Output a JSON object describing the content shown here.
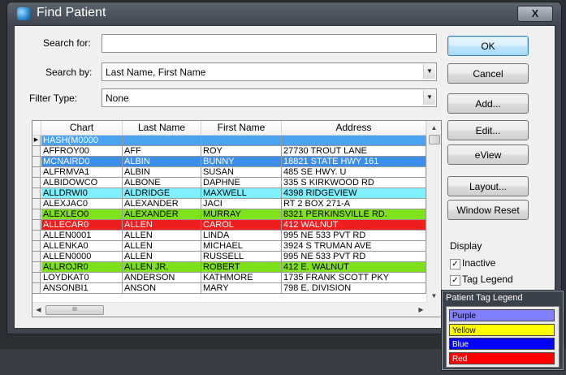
{
  "window": {
    "title": "Find Patient",
    "close_label": "X"
  },
  "search": {
    "search_for_label": "Search for:",
    "search_for_value": "",
    "search_by_label": "Search by:",
    "search_by_value": "Last Name, First Name",
    "filter_type_label": "Filter Type:",
    "filter_type_value": "None"
  },
  "buttons": {
    "ok": "OK",
    "cancel": "Cancel",
    "add": "Add...",
    "edit": "Edit...",
    "eview": "eView",
    "layout": "Layout...",
    "window_reset": "Window Reset"
  },
  "display": {
    "label": "Display",
    "inactive_label": "Inactive",
    "inactive_checked": true,
    "tag_legend_label": "Tag Legend",
    "tag_legend_checked": true
  },
  "grid": {
    "columns": [
      "Chart",
      "Last Name",
      "First Name",
      "Address"
    ],
    "rows": [
      {
        "cells": [
          "HASH(M0000",
          "",
          "",
          ""
        ],
        "tag": "selected",
        "current": true
      },
      {
        "cells": [
          "AFFROY00",
          "AFF",
          "ROY",
          "27730 TROUT LANE"
        ],
        "tag": "none"
      },
      {
        "cells": [
          "MCNAIRD0",
          "ALBIN",
          "BUNNY",
          "18821 STATE HWY 161"
        ],
        "tag": "blue"
      },
      {
        "cells": [
          "ALFRMVA1",
          "ALBIN",
          "SUSAN",
          "485 SE HWY. U"
        ],
        "tag": "none"
      },
      {
        "cells": [
          "ALBIDOWCO",
          "ALBONE",
          "DAPHNE",
          "335 S KIRKWOOD RD"
        ],
        "tag": "none"
      },
      {
        "cells": [
          "ALLDRWI0",
          "ALDRIDGE",
          "MAXWELL",
          "4398 RIDGEVIEW"
        ],
        "tag": "cyan"
      },
      {
        "cells": [
          "ALEXJAC0",
          "ALEXANDER",
          "JACI",
          "RT 2 BOX 271-A"
        ],
        "tag": "none"
      },
      {
        "cells": [
          "ALEXLEO0",
          "ALEXANDER",
          "MURRAY",
          "8321 PERKINSVILLE RD."
        ],
        "tag": "green"
      },
      {
        "cells": [
          "ALLECAR0",
          "ALLEN",
          "CAROL",
          "412 WALNUT"
        ],
        "tag": "red"
      },
      {
        "cells": [
          "ALLEN0001",
          "ALLEN",
          "LINDA",
          "995 NE 533 PVT RD"
        ],
        "tag": "none"
      },
      {
        "cells": [
          "ALLENKA0",
          "ALLEN",
          "MICHAEL",
          "3924 S TRUMAN AVE"
        ],
        "tag": "none"
      },
      {
        "cells": [
          "ALLEN0000",
          "ALLEN",
          "RUSSELL",
          "995 NE 533 PVT RD"
        ],
        "tag": "none"
      },
      {
        "cells": [
          "ALLROJR0",
          "ALLEN JR.",
          "ROBERT",
          "412 E. WALNUT"
        ],
        "tag": "green"
      },
      {
        "cells": [
          "LOYDKAT0",
          "ANDERSON",
          "KATHMORE",
          "1735 FRANK SCOTT PKY"
        ],
        "tag": "none"
      },
      {
        "cells": [
          "ANSONBI1",
          "ANSON",
          "MARY",
          "798 E. DIVISION"
        ],
        "tag": "none"
      }
    ],
    "scroll_grip": "III"
  },
  "tag_colors": {
    "selected": "#4aa3f0",
    "blue": "#3d8ee8",
    "cyan": "#7ff0ff",
    "green": "#7fe01c",
    "red": "#f01e1e",
    "none": "#ffffff"
  },
  "legend": {
    "title": "Patient Tag Legend",
    "items": [
      {
        "label": "Purple",
        "color": "#7f7fff"
      },
      {
        "label": "Yellow",
        "color": "#ffff00"
      },
      {
        "label": "Blue",
        "color": "#0000ff"
      },
      {
        "label": "Red",
        "color": "#ff0000"
      }
    ]
  }
}
